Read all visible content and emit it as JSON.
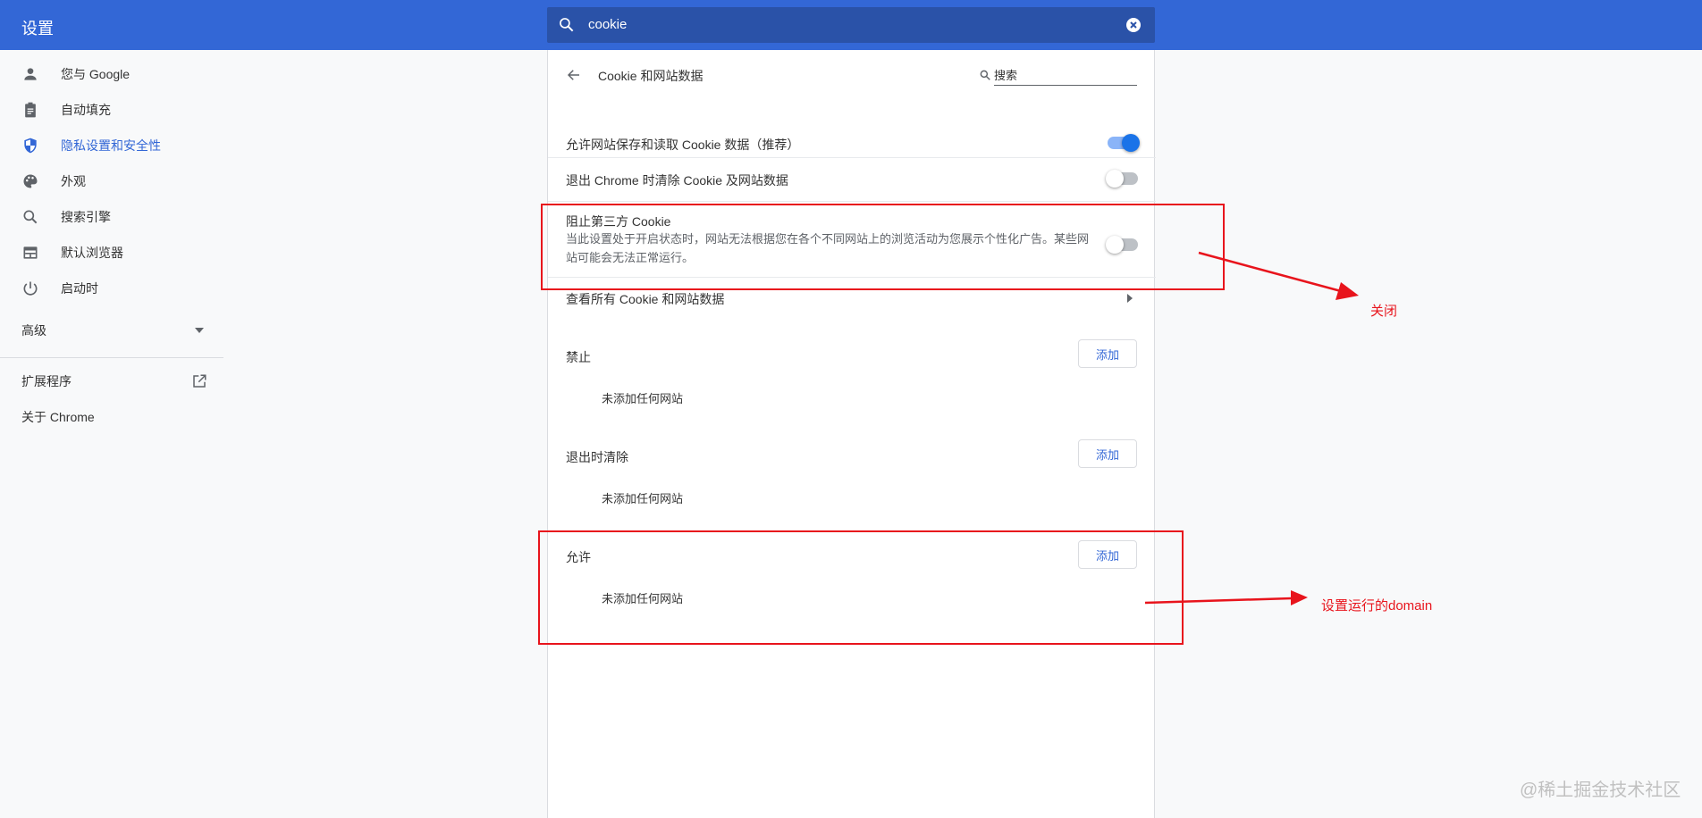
{
  "header": {
    "title": "设置",
    "search_value": "cookie"
  },
  "sidebar": {
    "items": [
      {
        "label": "您与 Google",
        "icon": "person-icon"
      },
      {
        "label": "自动填充",
        "icon": "clipboard-icon"
      },
      {
        "label": "隐私设置和安全性",
        "icon": "shield-icon",
        "active": true
      },
      {
        "label": "外观",
        "icon": "palette-icon"
      },
      {
        "label": "搜索引擎",
        "icon": "search-icon"
      },
      {
        "label": "默认浏览器",
        "icon": "browser-icon"
      },
      {
        "label": "启动时",
        "icon": "power-icon"
      }
    ],
    "advanced": "高级",
    "extensions": "扩展程序",
    "about": "关于 Chrome"
  },
  "panel": {
    "title": "Cookie 和网站数据",
    "search_placeholder": "搜索",
    "settings": [
      {
        "label": "允许网站保存和读取 Cookie 数据（推荐）",
        "enabled": true
      },
      {
        "label": "退出 Chrome 时清除 Cookie 及网站数据",
        "enabled": false
      },
      {
        "label": "阻止第三方 Cookie",
        "desc1": "当此设置处于开启状态时，网站无法根据您在各个不同网站上的浏览活动为您展示个性化广告。某些网",
        "desc2": "站可能会无法正常运行。",
        "enabled": false
      }
    ],
    "view_all": "查看所有 Cookie 和网站数据",
    "sections": [
      {
        "label": "禁止",
        "button": "添加",
        "empty": "未添加任何网站"
      },
      {
        "label": "退出时清除",
        "button": "添加",
        "empty": "未添加任何网站"
      },
      {
        "label": "允许",
        "button": "添加",
        "empty": "未添加任何网站"
      }
    ]
  },
  "annotations": {
    "close": "关闭",
    "set_domain": "设置运行的domain",
    "color": "#e8141c"
  },
  "watermark": "@稀土掘金技术社区",
  "colors": {
    "header": "#3367d6",
    "accent": "#1a73e8"
  }
}
